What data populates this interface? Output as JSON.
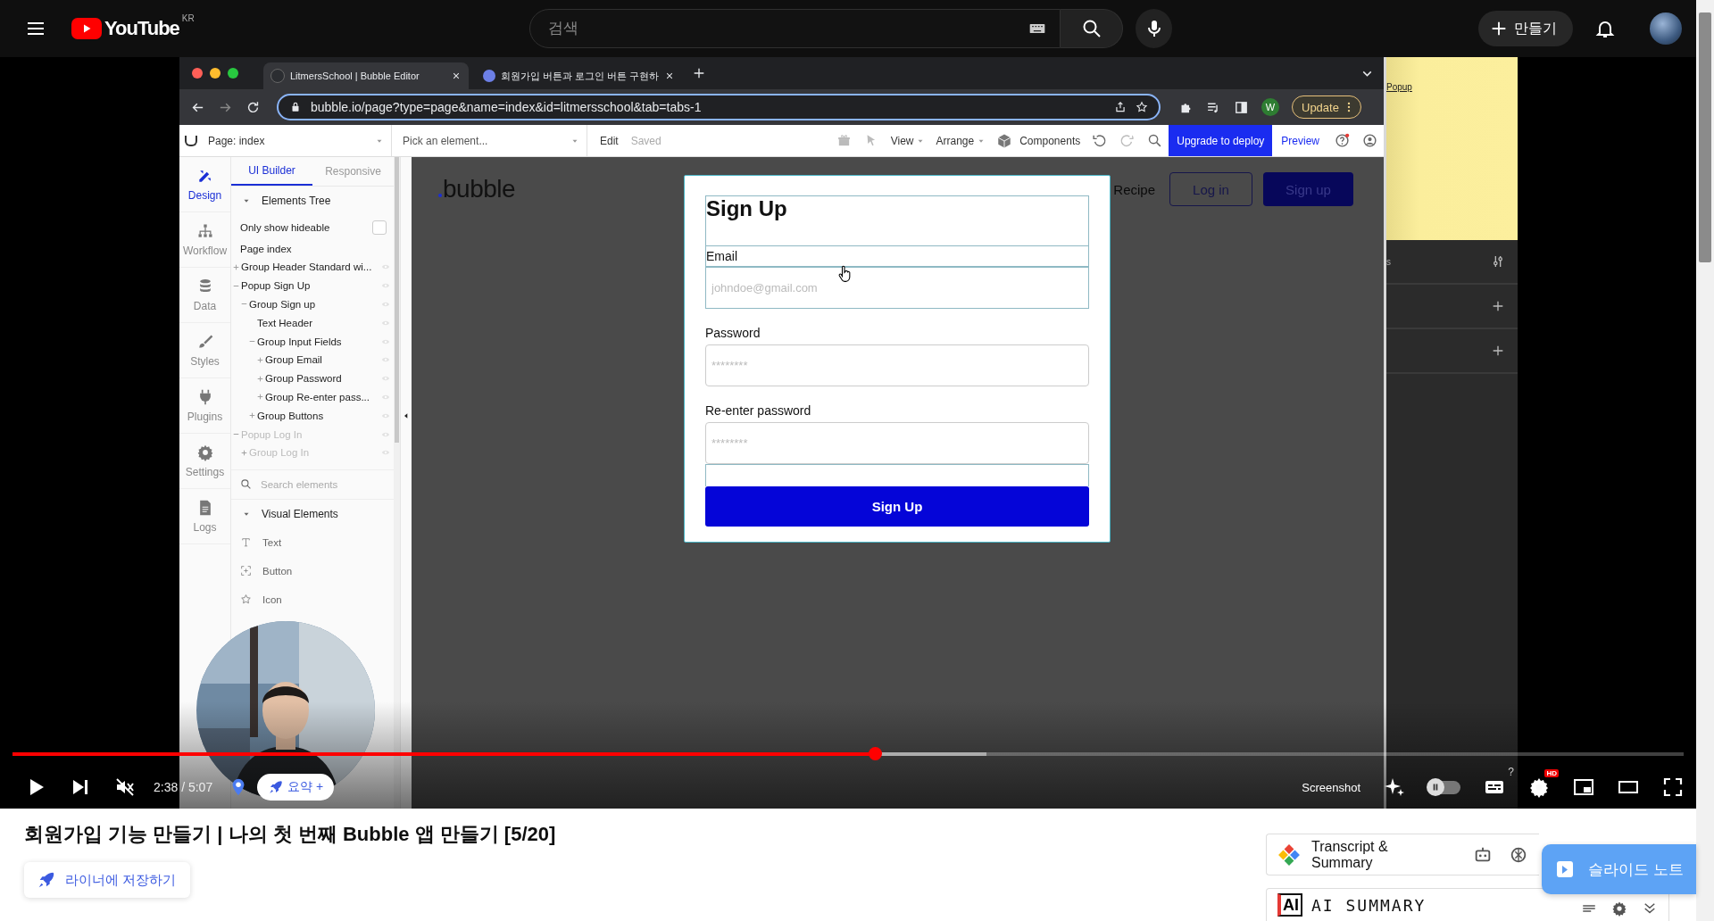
{
  "youtube": {
    "logo": "YouTube",
    "country": "KR",
    "search": {
      "placeholder": "검색"
    },
    "create_button": "만들기"
  },
  "browser": {
    "tabs": [
      {
        "title": "LitmersSchool | Bubble Editor",
        "selected": true
      },
      {
        "title": "회원가입 버튼과 로그인 버튼 구현하",
        "selected": false
      }
    ],
    "url": "bubble.io/page?type=page&name=index&id=litmersschool&tab=tabs-1",
    "profile": "W",
    "update_button": "Update"
  },
  "editor": {
    "toolbar": {
      "page": "Page: index",
      "element_picker": "Pick an element...",
      "edit": "Edit",
      "saved": "Saved",
      "view": "View",
      "arrange": "Arrange",
      "components": "Components",
      "deploy_button": "Upgrade to deploy",
      "preview": "Preview"
    },
    "nav": [
      {
        "label": "Design",
        "kind": "design",
        "selected": true
      },
      {
        "label": "Workflow",
        "kind": "workflow",
        "selected": false
      },
      {
        "label": "Data",
        "kind": "data",
        "selected": false
      },
      {
        "label": "Styles",
        "kind": "styles",
        "selected": false
      },
      {
        "label": "Plugins",
        "kind": "plugins",
        "selected": false
      },
      {
        "label": "Settings",
        "kind": "settings",
        "selected": false
      },
      {
        "label": "Logs",
        "kind": "logs",
        "selected": false
      }
    ],
    "panel_tabs": [
      {
        "label": "UI Builder",
        "selected": true
      },
      {
        "label": "Responsive",
        "selected": false
      }
    ],
    "tree": {
      "title": "Elements Tree",
      "expanded": true,
      "filter": {
        "label": "Only show hideable",
        "checked": false
      },
      "root": "Page index",
      "items": [
        {
          "label": "Group Header Standard wi...",
          "kind": "group",
          "expanded": false,
          "hidden": false
        },
        {
          "label": "Popup Sign Up",
          "kind": "group",
          "expanded": true,
          "hidden": false,
          "children": [
            {
              "label": "Group Sign up",
              "kind": "group",
              "expanded": true,
              "hidden": false,
              "children": [
                {
                  "label": "Text Header",
                  "kind": "leaf",
                  "hidden": false
                },
                {
                  "label": "Group Input Fields",
                  "kind": "group",
                  "expanded": true,
                  "hidden": false,
                  "children": [
                    {
                      "label": "Group Email",
                      "kind": "group",
                      "expanded": false,
                      "hidden": false
                    },
                    {
                      "label": "Group Password",
                      "kind": "group",
                      "expanded": false,
                      "hidden": false
                    },
                    {
                      "label": "Group Re-enter pass...",
                      "kind": "group",
                      "expanded": false,
                      "hidden": false
                    }
                  ]
                },
                {
                  "label": "Group Buttons",
                  "kind": "group",
                  "expanded": false,
                  "hidden": false
                }
              ]
            }
          ]
        },
        {
          "label": "Popup Log In",
          "kind": "group",
          "expanded": true,
          "hidden": true,
          "children": [
            {
              "label": "Group Log In",
              "kind": "group",
              "expanded": false,
              "hidden": true
            }
          ]
        }
      ]
    },
    "search": {
      "placeholder": "Search elements"
    },
    "visual_elements": {
      "title": "Visual Elements",
      "expanded": true,
      "items": [
        {
          "label": "Text",
          "kind": "text"
        },
        {
          "label": "Button",
          "kind": "button"
        },
        {
          "label": "Icon",
          "kind": "icon"
        }
      ]
    },
    "canvas": {
      "logo": "bubble",
      "nav_link": "Recipe",
      "login_button": "Log in",
      "signup_button": "Sign up"
    },
    "popup": {
      "title": "Sign Up",
      "fields": [
        {
          "label": "Email",
          "placeholder": "johndoe@gmail.com"
        },
        {
          "label": "Password",
          "placeholder": "********"
        },
        {
          "label": "Re-enter password",
          "placeholder": "********"
        }
      ],
      "button": "Sign Up"
    }
  },
  "side_panel": {
    "note": "Popup",
    "rows": [
      {
        "label": "s",
        "kind": "settings"
      },
      {
        "kind": "add"
      },
      {
        "kind": "add"
      }
    ]
  },
  "player": {
    "progress": {
      "level": 0.516
    },
    "buffered": {
      "level": 0.583
    },
    "muted": true,
    "time": "2:38 / 5:07",
    "summary_chip": "요약 +",
    "screenshot": "Screenshot",
    "autoplay": {
      "on": false
    },
    "captions_hint": "?",
    "quality_badge": "HD"
  },
  "title": "회원가입 기능 만들기 | 나의 첫 번째 Bubble 앱 만들기 [5/20]",
  "save_button": "라이너에 저장하기",
  "transcript": {
    "label": "Transcript & Summary"
  },
  "ai_summary": {
    "logo": "AI",
    "label": "AI SUMMARY"
  },
  "slide_note_button": "슬라이드 노트"
}
